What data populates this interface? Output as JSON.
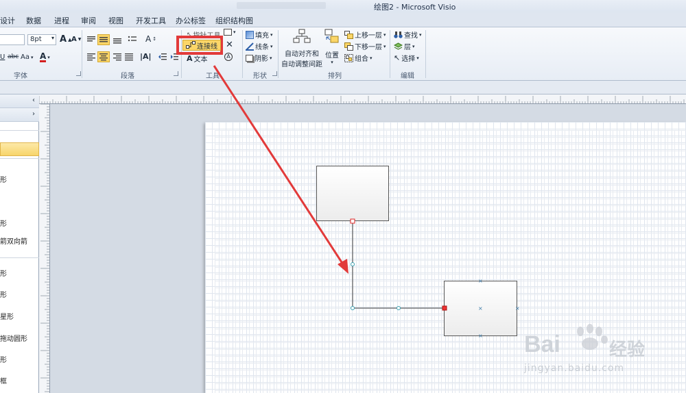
{
  "window": {
    "title": "绘图2 - Microsoft Visio"
  },
  "tabs": [
    {
      "id": "design",
      "label": "设计"
    },
    {
      "id": "data",
      "label": "数据"
    },
    {
      "id": "process",
      "label": "进程"
    },
    {
      "id": "review",
      "label": "审阅"
    },
    {
      "id": "view",
      "label": "视图"
    },
    {
      "id": "developer",
      "label": "开发工具"
    },
    {
      "id": "office-tab",
      "label": "办公标签"
    },
    {
      "id": "org-chart",
      "label": "组织结构图"
    }
  ],
  "ribbon": {
    "font": {
      "label": "字体",
      "size_value": "8pt",
      "grow_glyph": "A",
      "shrink_glyph": "A",
      "strike_label": "abc",
      "case_label": "Aa",
      "color_glyph": "A"
    },
    "paragraph": {
      "label": "段落"
    },
    "tools": {
      "label": "工具",
      "pointer_label": "指针工具",
      "connector_label": "连接线",
      "text_label": "文本"
    },
    "shape": {
      "label": "形状",
      "fill_label": "填充",
      "line_label": "线条",
      "shadow_label": "阴影"
    },
    "arrange": {
      "label": "排列",
      "auto_align_line1": "自动对齐和",
      "auto_align_line2": "自动调整间距",
      "position_label": "位置",
      "bring_forward_label": "上移一层",
      "send_backward_label": "下移一层",
      "group_label": "组合"
    },
    "editing": {
      "label": "编辑",
      "find_label": "查找",
      "layer_label": "层",
      "select_label": "选择"
    }
  },
  "shapes_panel": {
    "items": [
      "形",
      "形",
      "箭双向箭",
      "形",
      "形",
      "星形",
      "拖动圆形",
      "形",
      "框"
    ]
  },
  "watermark": {
    "text": "Bai",
    "brand": "经验",
    "url": "jingyan.baidu.com"
  },
  "colors": {
    "accent": "#fbd668",
    "annotation_red": "#e23a3a",
    "connector": "#3a3a3a"
  }
}
